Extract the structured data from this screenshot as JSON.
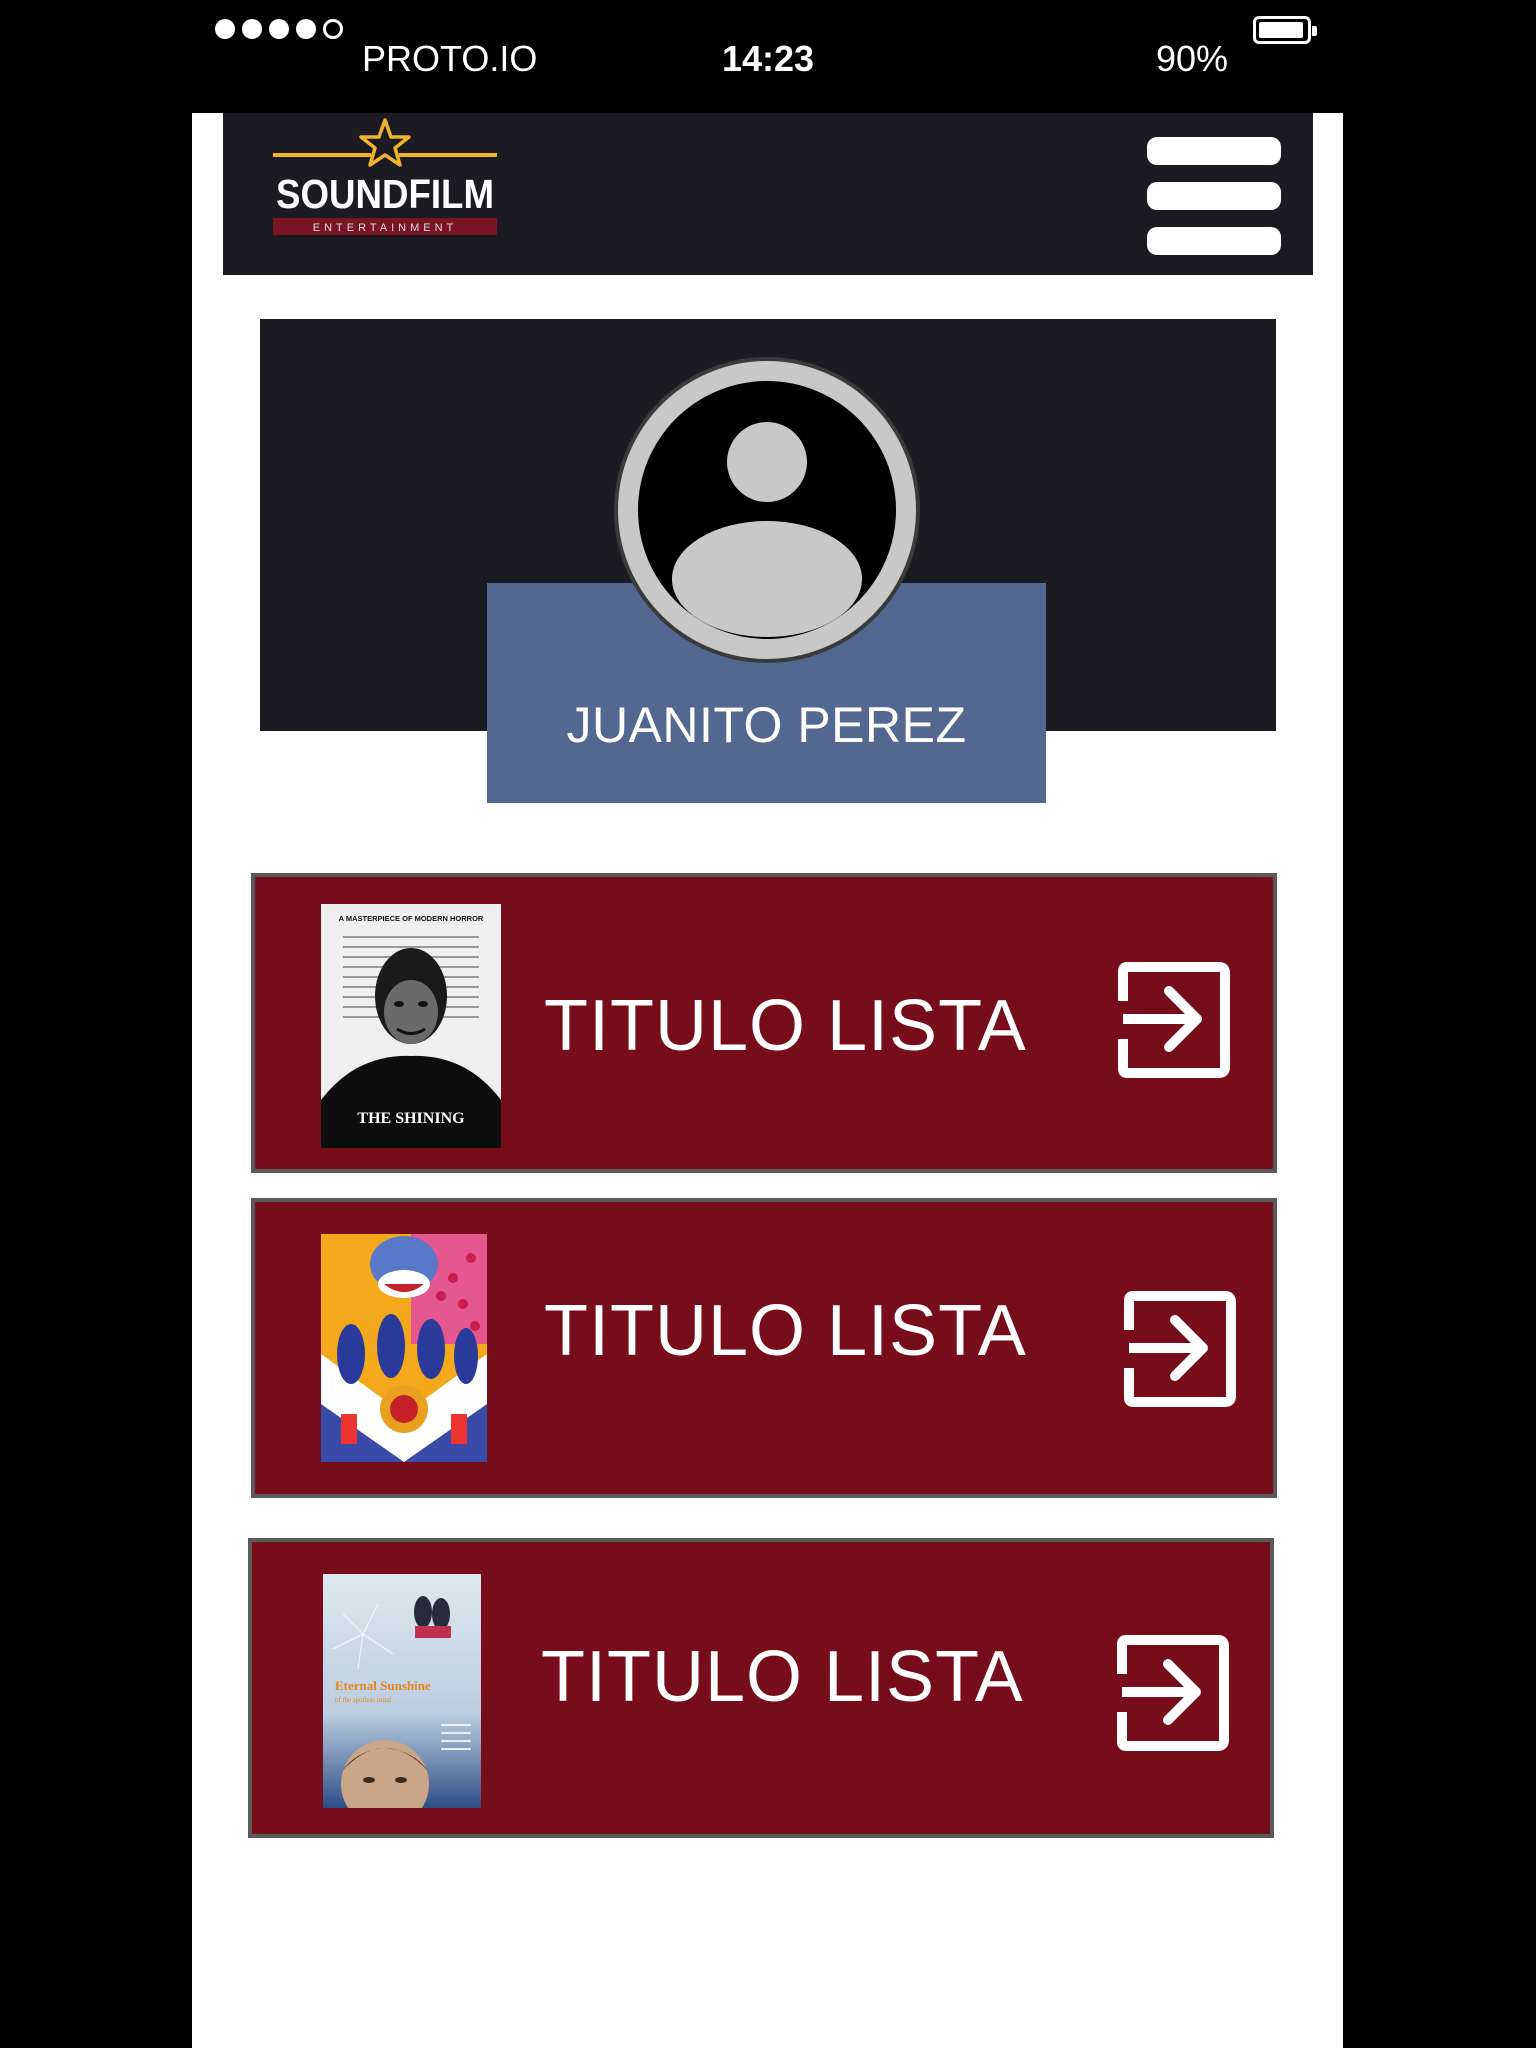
{
  "status_bar": {
    "carrier": "PROTO.IO",
    "time": "14:23",
    "battery": "90%",
    "signal_bars_filled": 4,
    "signal_bars_total": 5
  },
  "header": {
    "logo": {
      "name": "SOUNDFILM",
      "tagline": "ENTERTAINMENT"
    },
    "menu_icon": "hamburger-menu-icon"
  },
  "profile": {
    "avatar_icon": "user-avatar-icon",
    "name": "JUANITO PEREZ"
  },
  "lists": [
    {
      "title": "TITULO LISTA",
      "poster": {
        "tagline": "A MASTERPIECE OF MODERN HORROR",
        "title": "THE SHINING"
      },
      "icon": "enter-icon"
    },
    {
      "title": "TITULO LISTA",
      "poster": {
        "description": "Yellow Submarine illustrated poster"
      },
      "icon": "enter-icon"
    },
    {
      "title": "TITULO LISTA",
      "poster": {
        "title": "Eternal Sunshine",
        "subtitle": "of the spotless mind"
      },
      "icon": "enter-icon"
    }
  ],
  "colors": {
    "header_bg": "#1d1b22",
    "card_bg": "#770c1b",
    "name_box": "#536891",
    "logo_accent": "#f0b429"
  }
}
